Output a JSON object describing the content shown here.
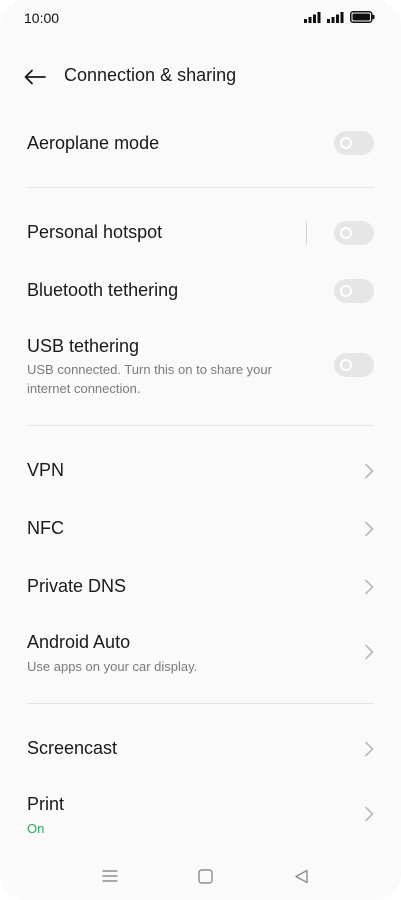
{
  "status_bar": {
    "time": "10:00",
    "icons": [
      "signal-icon",
      "signal-icon",
      "battery-icon"
    ]
  },
  "header": {
    "back_icon": "arrow-left-icon",
    "title": "Connection & sharing"
  },
  "rows": {
    "aeroplane": {
      "title": "Aeroplane mode",
      "toggle_on": false
    },
    "hotspot": {
      "title": "Personal hotspot",
      "toggle_on": false
    },
    "bluetooth": {
      "title": "Bluetooth tethering",
      "toggle_on": false
    },
    "usb": {
      "title": "USB tethering",
      "subtitle": "USB connected. Turn this on to share your internet connection.",
      "toggle_on": false
    },
    "vpn": {
      "title": "VPN"
    },
    "nfc": {
      "title": "NFC"
    },
    "dns": {
      "title": "Private DNS"
    },
    "android_auto": {
      "title": "Android Auto",
      "subtitle": "Use apps on your car display."
    },
    "screencast": {
      "title": "Screencast"
    },
    "print": {
      "title": "Print",
      "subtitle": "On"
    }
  },
  "colors": {
    "background": "#fafafa",
    "text": "#1a1a1a",
    "subtext": "#7a7a7a",
    "accent_green": "#1fae5a",
    "toggle_off": "#e6e6e6"
  },
  "nav_bar": {
    "icons": [
      "menu-icon",
      "home-square-icon",
      "back-triangle-icon"
    ]
  }
}
